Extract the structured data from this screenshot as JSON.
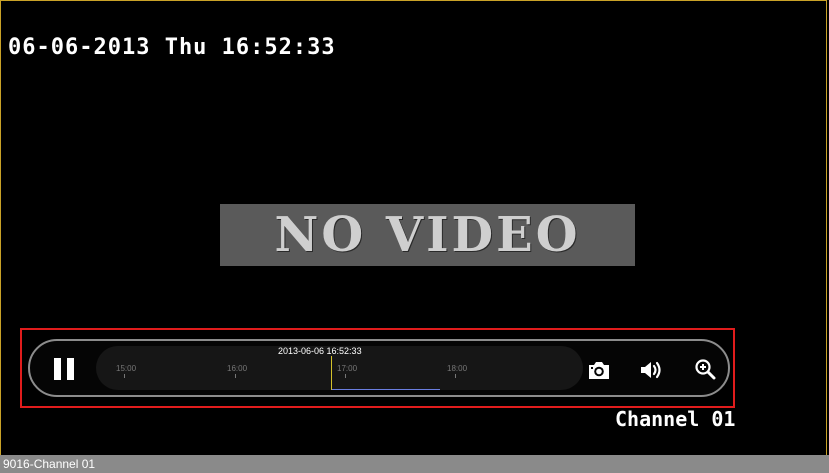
{
  "video": {
    "osd_datetime": "06-06-2013 Thu 16:52:33",
    "no_video_text": "NO VIDEO",
    "channel_label": "Channel 01"
  },
  "playback": {
    "current_time": "2013-06-06 16:52:33",
    "ticks": [
      "15:00",
      "16:00",
      "17:00",
      "18:00"
    ],
    "record_color": "#6a7ee0",
    "cursor_color": "#d4c22a"
  },
  "controls": {
    "pause": "pause-icon",
    "snapshot": "camera-icon",
    "audio": "speaker-icon",
    "zoom": "zoom-in-icon"
  },
  "footer": {
    "camera_name": "9016-Channel 01"
  }
}
